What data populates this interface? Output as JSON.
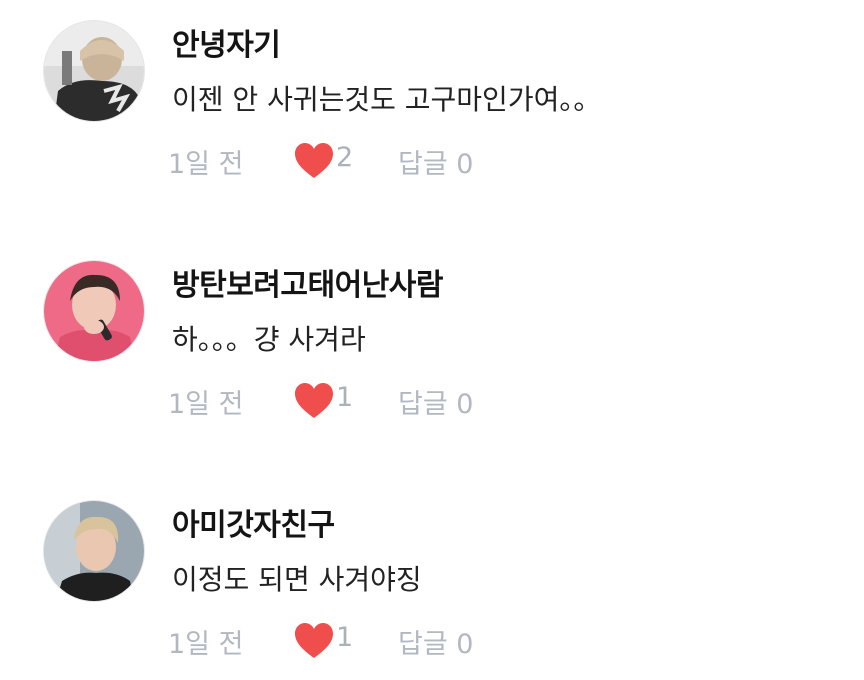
{
  "comments": [
    {
      "username": "안녕자기",
      "text": "이젠 안 사귀는것도 고구마인가여。。",
      "time": "1일 전",
      "likes": "2",
      "reply_label": "답글",
      "reply_count": "0"
    },
    {
      "username": "방탄보려고태어난사람",
      "text": "하。。。걍 사겨라",
      "time": "1일 전",
      "likes": "1",
      "reply_label": "답글",
      "reply_count": "0"
    },
    {
      "username": "아미갓자친구",
      "text": "이정도 되면 사겨야징",
      "time": "1일 전",
      "likes": "1",
      "reply_label": "답글",
      "reply_count": "0"
    }
  ],
  "colors": {
    "heart": "#f04d4d",
    "meta_text": "#b2b8c2",
    "username": "#141414"
  },
  "icons": {
    "like": "heart-icon"
  }
}
